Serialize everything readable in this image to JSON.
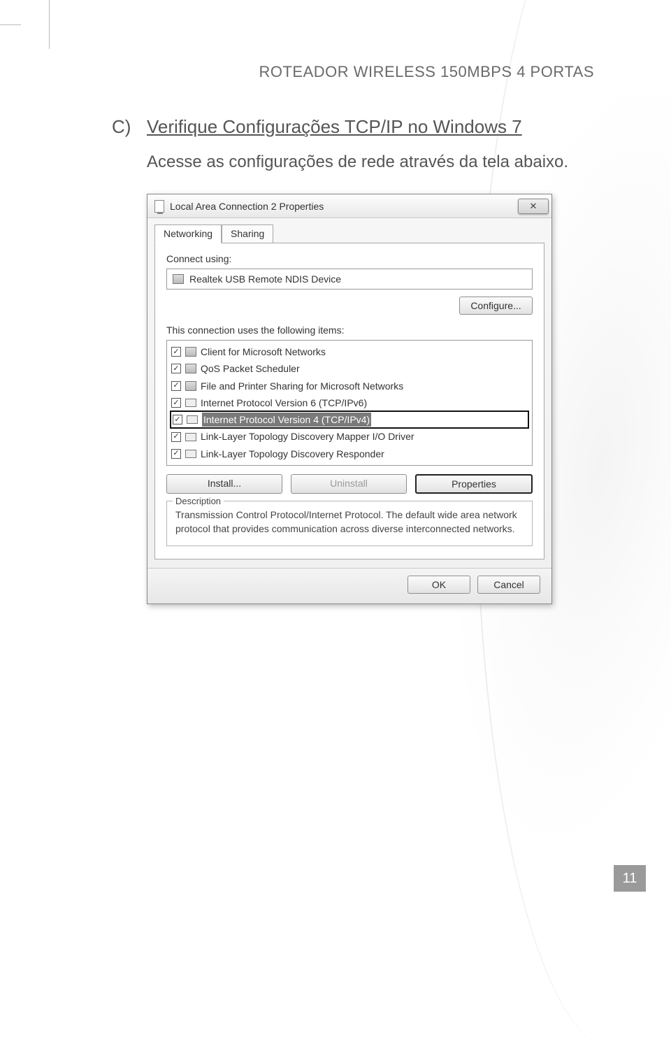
{
  "header": {
    "running_head": "ROTEADOR WIRELESS 150MBPS 4 PORTAS"
  },
  "section": {
    "letter": "C)",
    "title": "Verifique Configurações TCP/IP no Windows 7",
    "body": "Acesse as configurações de rede através da tela abaixo."
  },
  "dialog": {
    "title": "Local Area Connection 2 Properties",
    "close_glyph": "✕",
    "tabs": {
      "networking": "Networking",
      "sharing": "Sharing"
    },
    "connect_using_label": "Connect using:",
    "adapter_name": "Realtek USB Remote NDIS Device",
    "configure_btn": "Configure...",
    "items_label": "This connection uses the following items:",
    "items": [
      {
        "label": "Client for Microsoft Networks"
      },
      {
        "label": "QoS Packet Scheduler"
      },
      {
        "label": "File and Printer Sharing for Microsoft Networks"
      },
      {
        "label": "Internet Protocol Version 6 (TCP/IPv6)"
      },
      {
        "label": "Internet Protocol Version 4 (TCP/IPv4)"
      },
      {
        "label": "Link-Layer Topology Discovery Mapper I/O Driver"
      },
      {
        "label": "Link-Layer Topology Discovery Responder"
      }
    ],
    "install_btn": "Install...",
    "uninstall_btn": "Uninstall",
    "properties_btn": "Properties",
    "description_legend": "Description",
    "description_text": "Transmission Control Protocol/Internet Protocol. The default wide area network protocol that provides communication across diverse interconnected networks.",
    "ok_btn": "OK",
    "cancel_btn": "Cancel"
  },
  "page_number": "11"
}
